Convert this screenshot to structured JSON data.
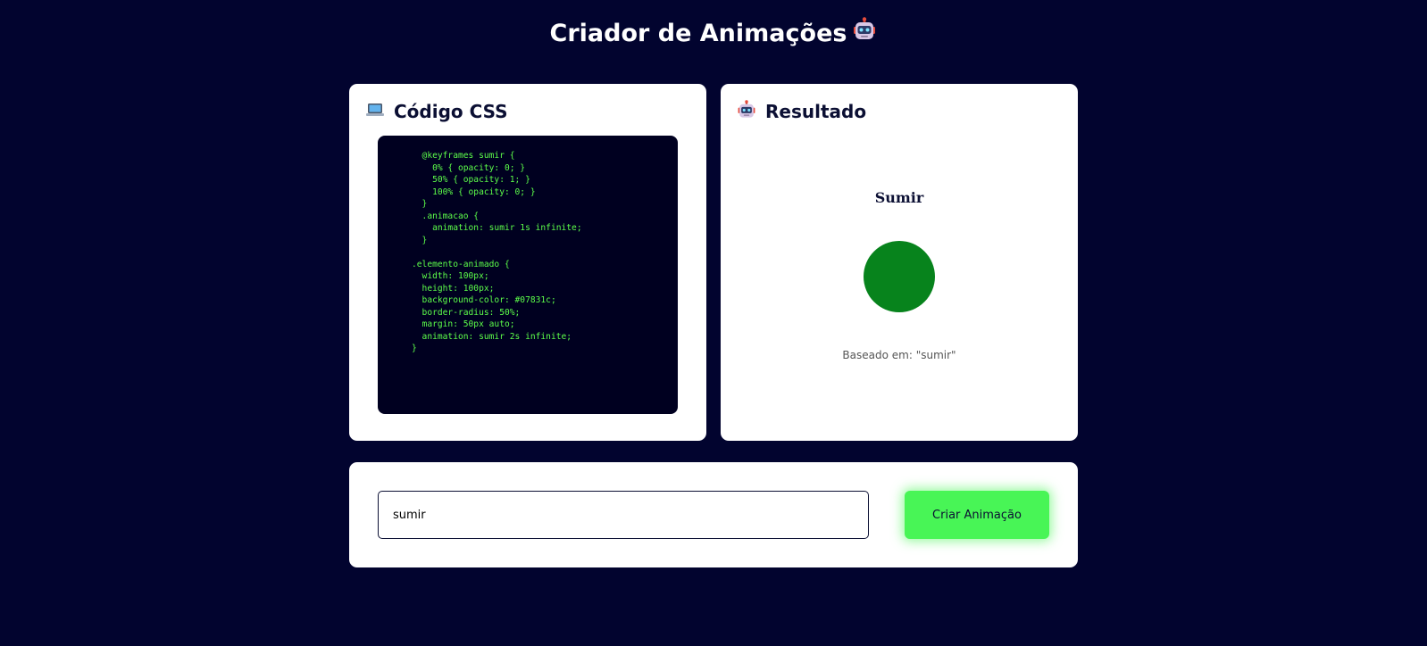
{
  "header": {
    "title": "Criador de Animações",
    "icon": "robot-icon"
  },
  "code_panel": {
    "title": "Código CSS",
    "icon": "laptop-icon",
    "code": "  @keyframes sumir {\n    0% { opacity: 0; }\n    50% { opacity: 1; }\n    100% { opacity: 0; }\n  }\n  .animacao {\n    animation: sumir 1s infinite;\n  }\n\n.elemento-animado {\n  width: 100px;\n  height: 100px;\n  background-color: #07831c;\n  border-radius: 50%;\n  margin: 50px auto;\n  animation: sumir 2s infinite;\n}"
  },
  "result_panel": {
    "title": "Resultado",
    "icon": "robot-icon",
    "animation_name": "Sumir",
    "circle_color": "#07831c",
    "caption": "Baseado em: \"sumir\""
  },
  "form": {
    "input_value": "sumir",
    "button_label": "Criar Animação"
  },
  "colors": {
    "background": "#02042f",
    "accent": "#48f556",
    "code_text": "#5dff4a"
  }
}
